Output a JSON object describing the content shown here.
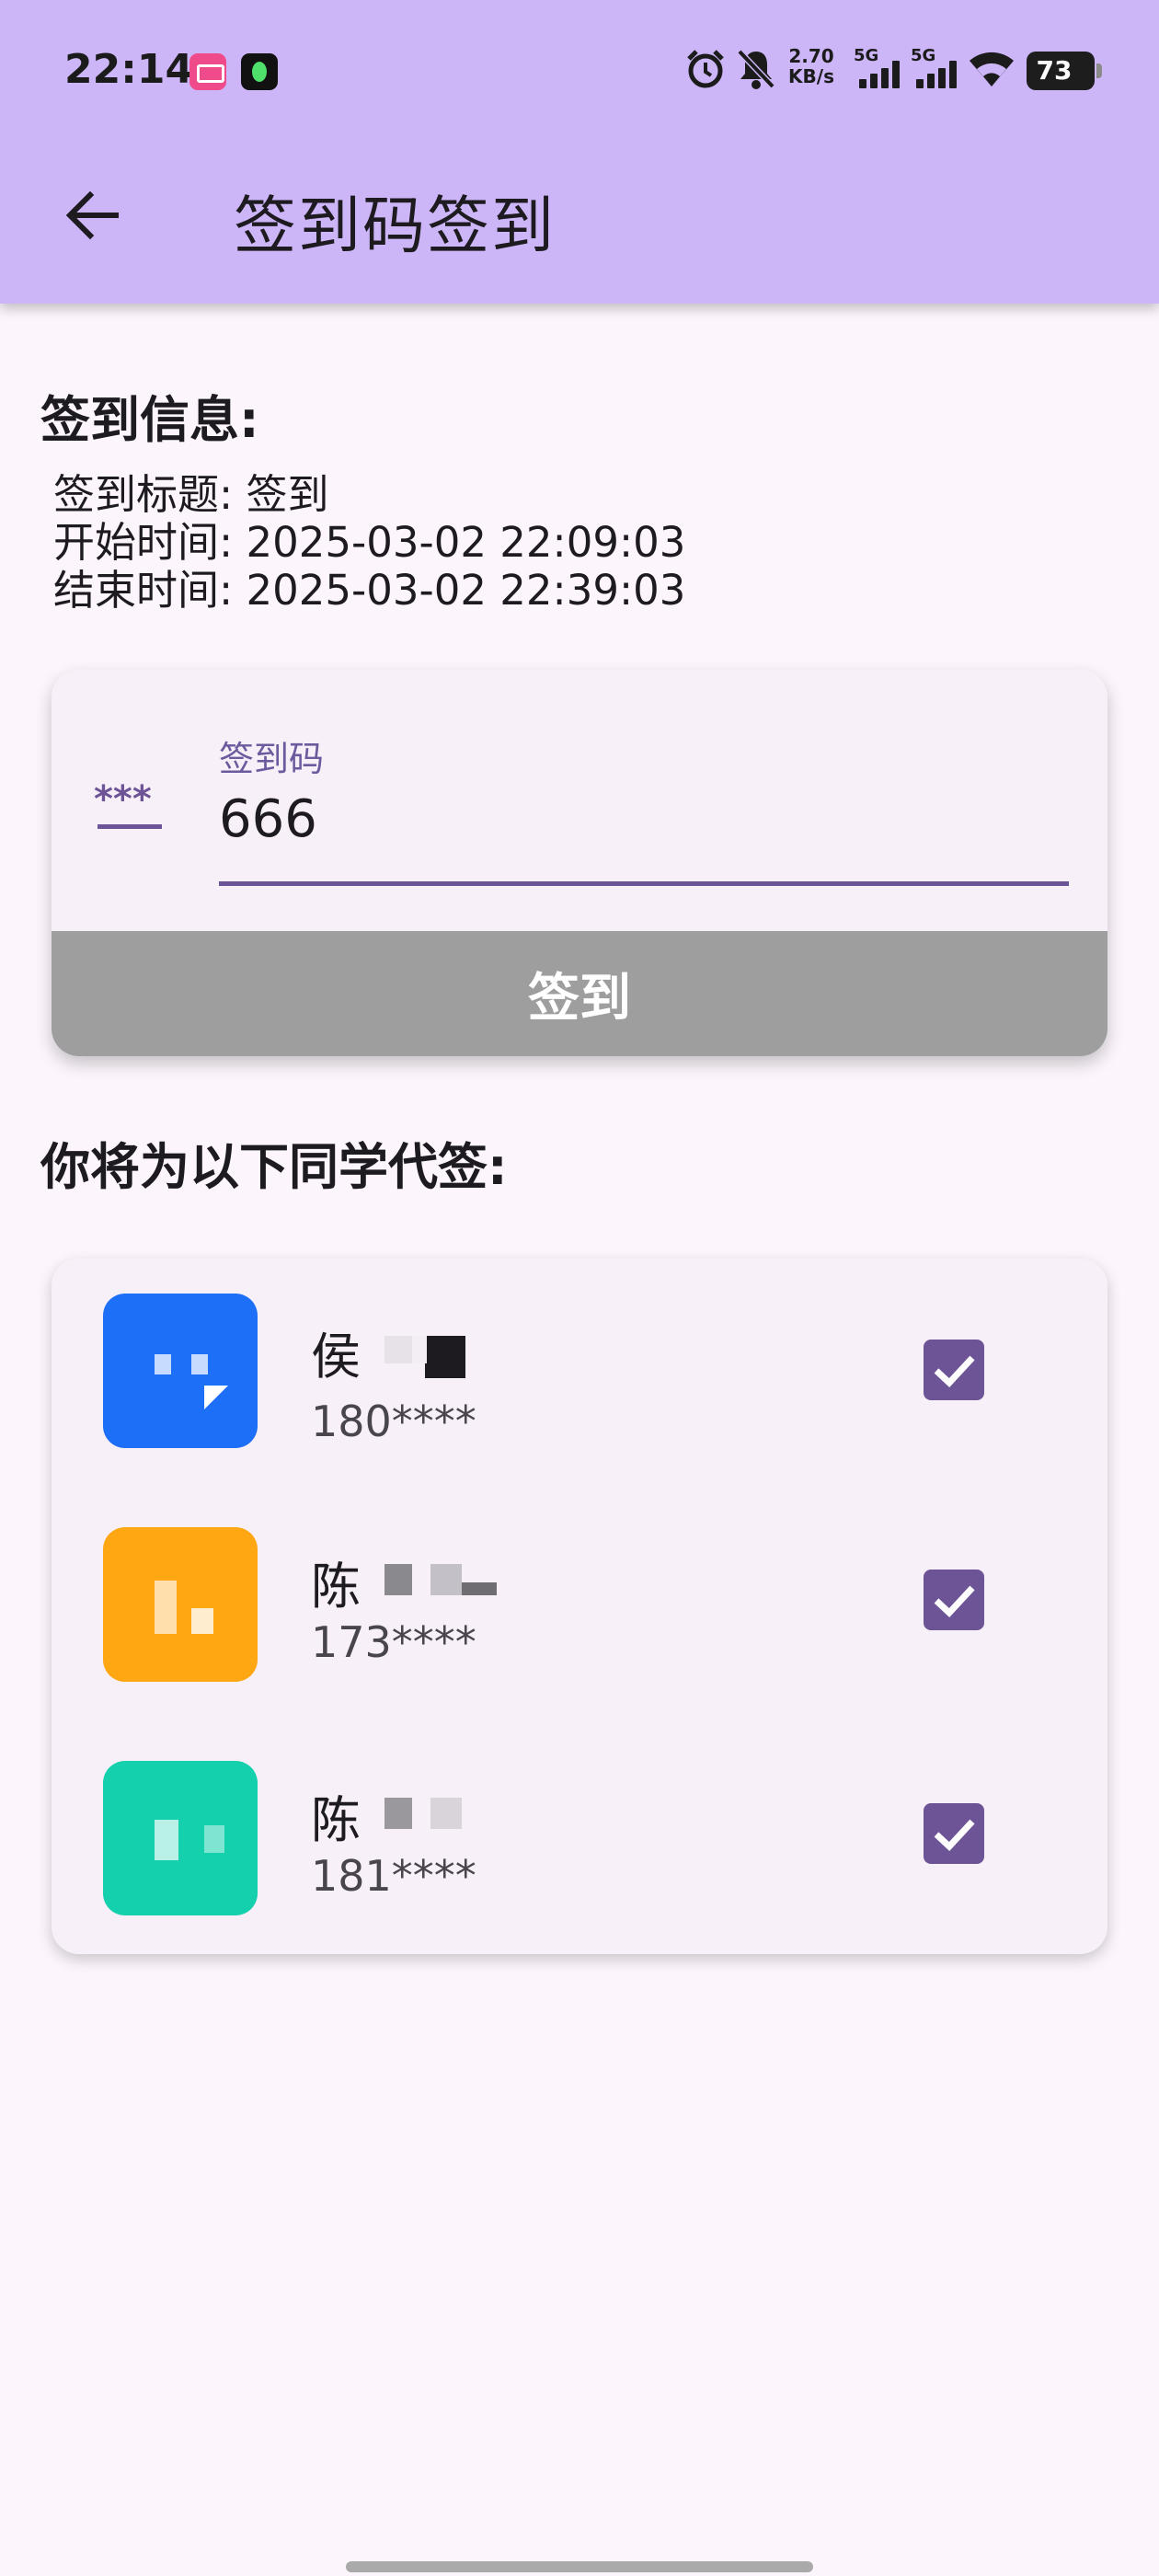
{
  "status_bar": {
    "time": "22:14",
    "net_speed_value": "2.70",
    "net_speed_unit": "KB/s",
    "sim1_label": "5G",
    "sim2_label": "5G",
    "battery_level": "73",
    "icons": [
      "alarm-icon",
      "mute-icon",
      "wifi-icon",
      "battery-icon"
    ]
  },
  "app_bar": {
    "back_icon": "arrow-left-icon",
    "title": "签到码签到"
  },
  "sign_info": {
    "heading": "签到信息:",
    "lines": [
      "签到标题: 签到",
      "开始时间: 2025-03-02 22:09:03",
      "结束时间: 2025-03-02 22:39:03"
    ]
  },
  "code_form": {
    "leading_icon": "password-icon",
    "label": "签到码",
    "value": "666",
    "submit_label": "签到"
  },
  "proxy_section": {
    "heading": "你将为以下同学代签:",
    "students": [
      {
        "name": "侯",
        "phone": "180****",
        "checked": true,
        "avatar_color": "#1e6ff7"
      },
      {
        "name": "陈",
        "phone": "173****",
        "checked": true,
        "avatar_color": "#ffa613"
      },
      {
        "name": "陈",
        "phone": "181****",
        "checked": true,
        "avatar_color": "#14d0ad"
      }
    ]
  },
  "colors": {
    "app_bar": "#cdb6f7",
    "background": "#fcf6fc",
    "accent": "#6c5496",
    "button_disabled": "#9e9e9e"
  }
}
